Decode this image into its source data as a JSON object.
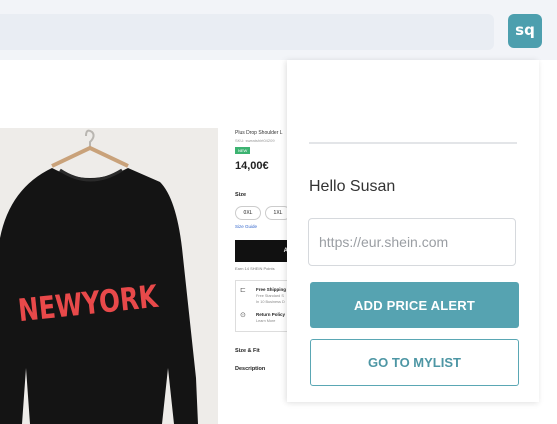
{
  "browser": {
    "extension_label": "sq",
    "accent_color": "#4d9fae"
  },
  "product": {
    "title": "Plus Drop Shoulder L",
    "sku": "SKU: sweatshirt04209",
    "badge": "NEW",
    "price": "14,00€",
    "size_label": "Size",
    "sizes": [
      "0XL",
      "1XL"
    ],
    "size_guide": "Size Guide",
    "add_label": "A",
    "earn_points": "Earn 14 SHEIN Points",
    "shipping_title": "Free Shipping",
    "shipping_line1": "Free Standard S",
    "shipping_line2": "In 10 Business D",
    "return_title": "Return Policy",
    "return_sub": "Learn More",
    "size_fit": "Size & Fit",
    "description": "Description",
    "print_text": "NEWYORK"
  },
  "popup": {
    "greeting": "Hello Susan",
    "url_placeholder": "https://eur.shein.com",
    "add_price_alert": "ADD PRICE ALERT",
    "go_to_mylist": "GO TO MYLIST",
    "primary_color": "#56a3b1"
  }
}
